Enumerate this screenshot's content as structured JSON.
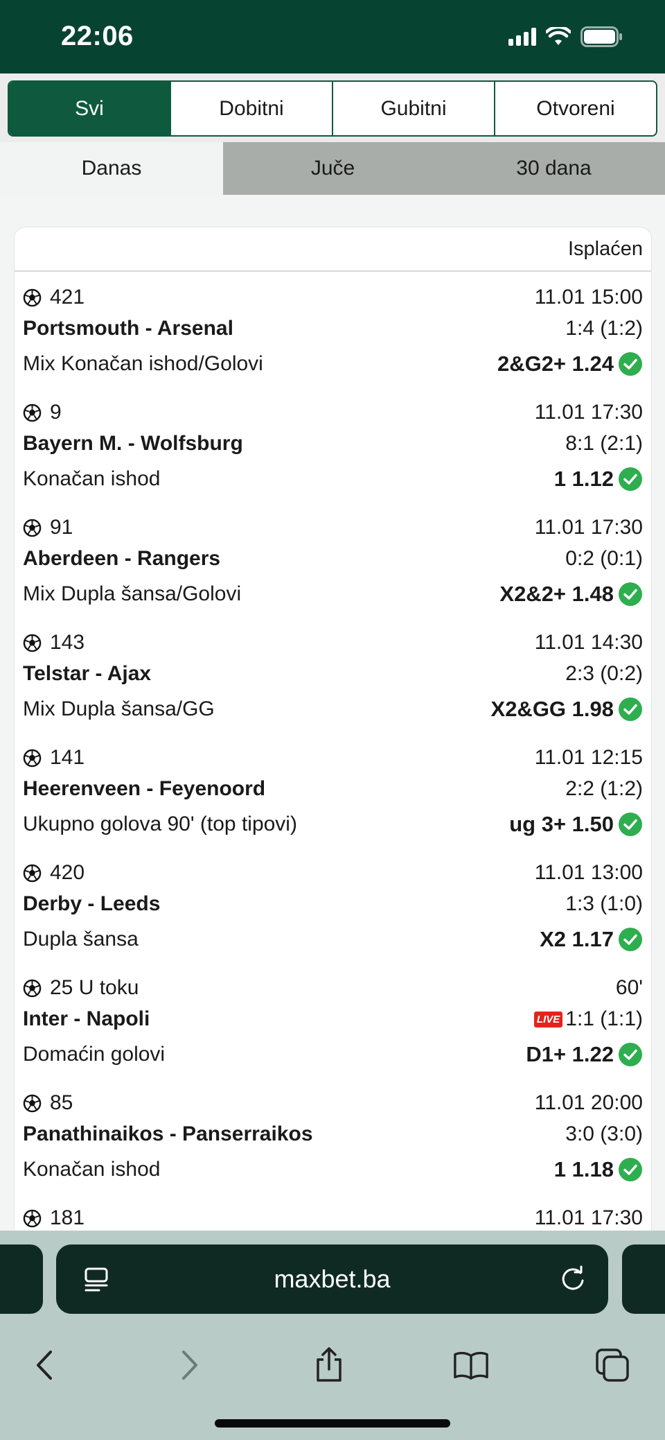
{
  "status_bar": {
    "time": "22:06"
  },
  "filter_tabs": [
    "Svi",
    "Dobitni",
    "Gubitni",
    "Otvoreni"
  ],
  "period_tabs": [
    "Danas",
    "Juče",
    "30 dana"
  ],
  "card": {
    "status": "Isplaćen",
    "matches": [
      {
        "code": "421",
        "time": "11.01 15:00",
        "teams": "Portsmouth - Arsenal",
        "score": "1:4 (1:2)",
        "market": "Mix Konačan ishod/Golovi",
        "tip": "2&G2+ 1.24"
      },
      {
        "code": "9",
        "time": "11.01 17:30",
        "teams": "Bayern M. - Wolfsburg",
        "score": "8:1 (2:1)",
        "market": "Konačan ishod",
        "tip": "1 1.12"
      },
      {
        "code": "91",
        "time": "11.01 17:30",
        "teams": "Aberdeen - Rangers",
        "score": "0:2 (0:1)",
        "market": "Mix Dupla šansa/Golovi",
        "tip": "X2&2+ 1.48"
      },
      {
        "code": "143",
        "time": "11.01 14:30",
        "teams": "Telstar - Ajax",
        "score": "2:3 (0:2)",
        "market": "Mix Dupla šansa/GG",
        "tip": "X2&GG 1.98"
      },
      {
        "code": "141",
        "time": "11.01 12:15",
        "teams": "Heerenveen - Feyenoord",
        "score": "2:2 (1:2)",
        "market": "Ukupno golova 90' (top tipovi)",
        "tip": "ug 3+ 1.50"
      },
      {
        "code": "420",
        "time": "11.01 13:00",
        "teams": "Derby - Leeds",
        "score": "1:3 (1:0)",
        "market": "Dupla šansa",
        "tip": "X2 1.17"
      },
      {
        "code": "25 U toku",
        "time": "60'",
        "teams": "Inter - Napoli",
        "score": "1:1 (1:1)",
        "live": "LIVE",
        "market": "Domaćin golovi",
        "tip": "D1+ 1.22"
      },
      {
        "code": "85",
        "time": "11.01 20:00",
        "teams": "Panathinaikos - Panserraikos",
        "score": "3:0 (3:0)",
        "market": "Konačan ishod",
        "tip": "1 1.18"
      },
      {
        "code": "181",
        "time": "11.01 17:30"
      }
    ]
  },
  "browser": {
    "url": "maxbet.ba"
  },
  "colors": {
    "brand_green": "#064330",
    "tab_green": "#0f5a3e",
    "success": "#2eae4f",
    "live_red": "#e5231b"
  }
}
